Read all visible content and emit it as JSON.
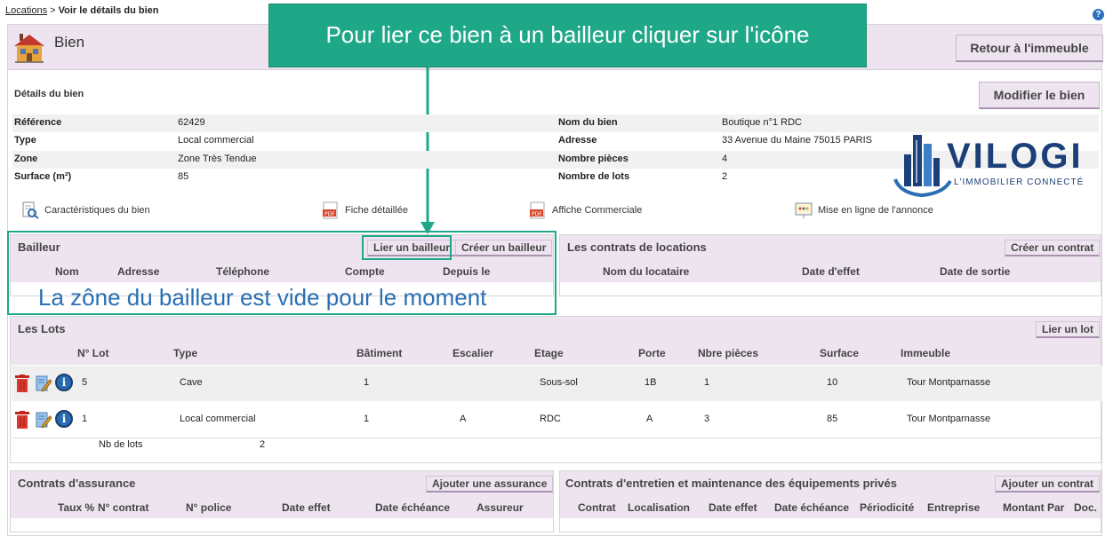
{
  "breadcrumb": {
    "parent": "Locations",
    "separator": " > ",
    "current": "Voir le détails du bien"
  },
  "header": {
    "title": "Bien",
    "back_button": "Retour à l'immeuble"
  },
  "callout": {
    "text": "Pour lier ce bien à un bailleur cliquer sur l'icône",
    "color": "#1fa888"
  },
  "details": {
    "title": "Détails du bien",
    "edit_button": "Modifier le bien",
    "rows": [
      {
        "l1": "Référence",
        "v1": "62429",
        "l2": "Nom du bien",
        "v2": "Boutique n°1 RDC"
      },
      {
        "l1": "Type",
        "v1": "Local commercial",
        "l2": "Adresse",
        "v2": "33 Avenue du Maine 75015 PARIS"
      },
      {
        "l1": "Zone",
        "v1": "Zone Très Tendue",
        "l2": "Nombre pièces",
        "v2": "4"
      },
      {
        "l1": "Surface (m²)",
        "v1": "85",
        "l2": "Nombre de lots",
        "v2": "2"
      }
    ]
  },
  "logo": {
    "name": "VILOGI",
    "tagline": "L'IMMOBILIER CONNECTÉ",
    "color": "#1b3f78"
  },
  "documents": [
    {
      "label": "Caractéristiques du bien",
      "icon": "search-document-icon"
    },
    {
      "label": "Fiche détaillée",
      "icon": "pdf-icon"
    },
    {
      "label": "Affiche Commerciale",
      "icon": "pdf-icon"
    },
    {
      "label": "Mise en ligne de l'annonce",
      "icon": "presentation-icon"
    }
  ],
  "bailleur": {
    "title": "Bailleur",
    "link_button": "Lier un bailleur",
    "create_button": "Créer un bailleur",
    "columns": [
      "Nom",
      "Adresse",
      "Téléphone",
      "Compte",
      "Depuis le"
    ],
    "empty_note": "La zône du bailleur est vide pour le moment"
  },
  "contrats_locations": {
    "title": "Les contrats de locations",
    "create_button": "Créer un contrat",
    "columns": [
      "Nom du locataire",
      "Date d'effet",
      "Date de sortie"
    ]
  },
  "lots": {
    "title": "Les Lots",
    "link_button": "Lier un lot",
    "columns": [
      "N° Lot",
      "Type",
      "Bâtiment",
      "Escalier",
      "Etage",
      "Porte",
      "Nbre pièces",
      "Surface",
      "Immeuble"
    ],
    "rows": [
      {
        "lot": "5",
        "type": "Cave",
        "batiment": "1",
        "escalier": "",
        "etage": "Sous-sol",
        "porte": "1B",
        "pieces": "1",
        "surface": "10",
        "immeuble": "Tour Montparnasse"
      },
      {
        "lot": "1",
        "type": "Local commercial",
        "batiment": "1",
        "escalier": "A",
        "etage": "RDC",
        "porte": "A",
        "pieces": "3",
        "surface": "85",
        "immeuble": "Tour Montparnasse"
      }
    ],
    "count_label": "Nb de lots",
    "count_value": "2"
  },
  "assurance": {
    "title": "Contrats d'assurance",
    "add_button": "Ajouter une assurance",
    "columns": [
      "Taux %",
      "N° contrat",
      "N° police",
      "Date effet",
      "Date échéance",
      "Assureur"
    ]
  },
  "entretien": {
    "title": "Contrats d'entretien et maintenance des équipements privés",
    "add_button": "Ajouter un contrat",
    "columns": [
      "Contrat",
      "Localisation",
      "Date effet",
      "Date échéance",
      "Périodicité",
      "Entreprise",
      "Montant Par",
      "Doc."
    ]
  }
}
